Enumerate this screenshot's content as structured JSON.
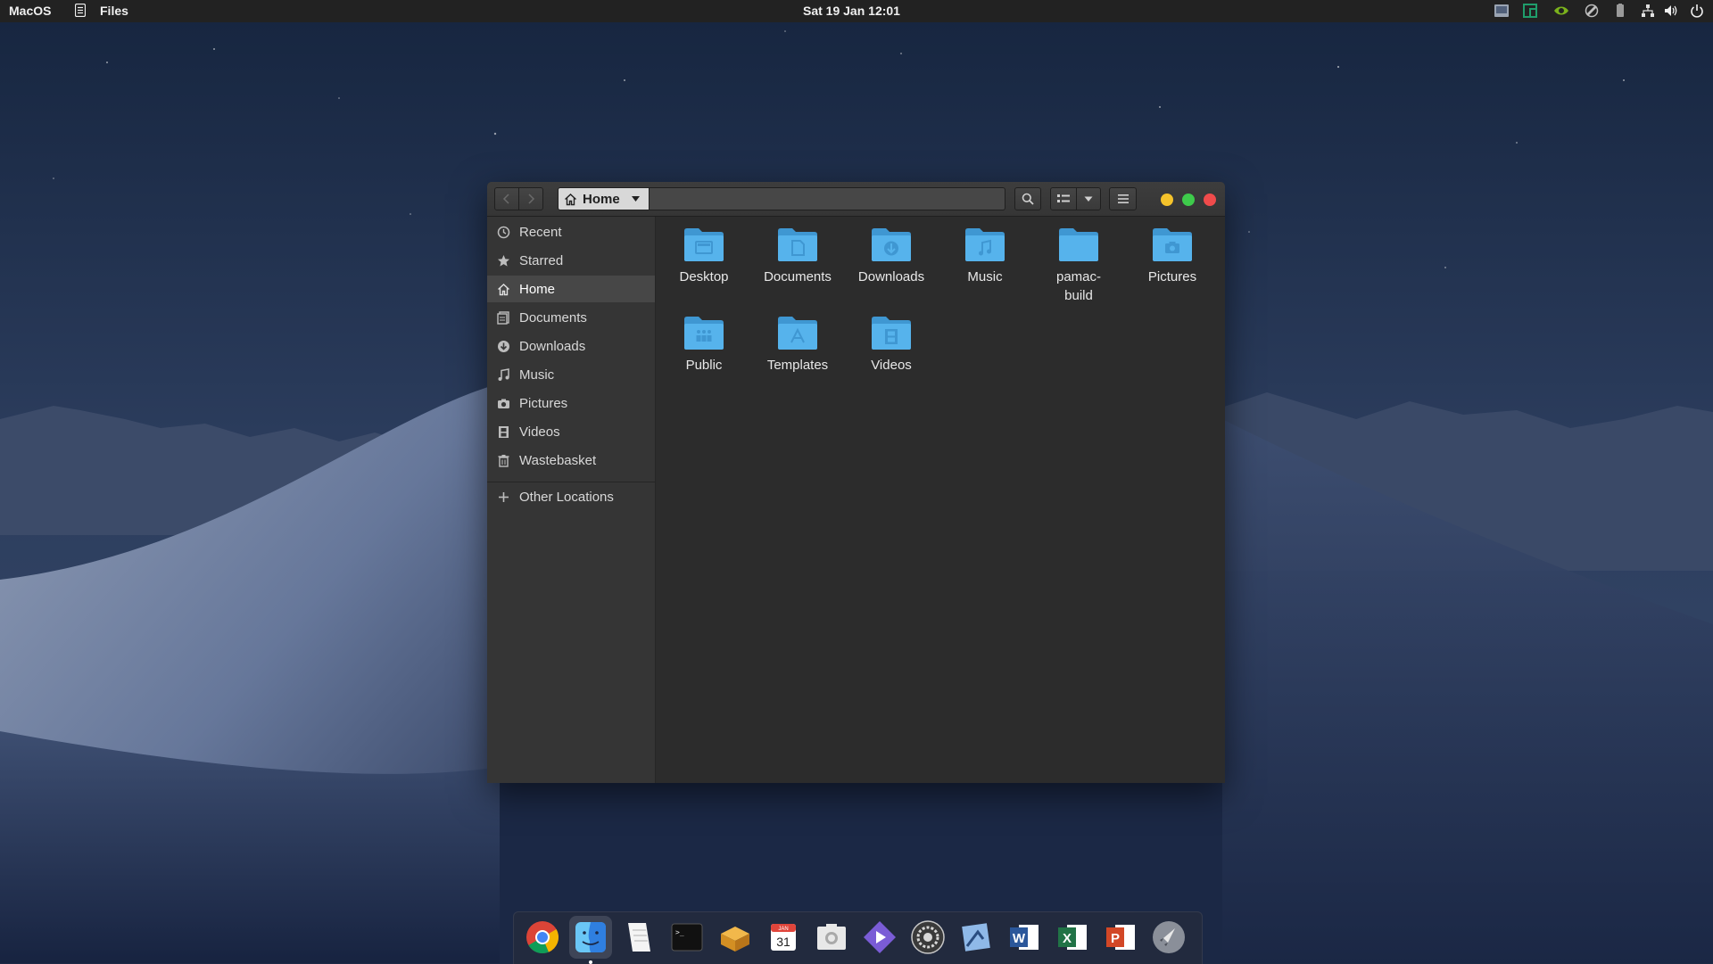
{
  "topbar": {
    "app_menu": "MacOS",
    "active_app": "Files",
    "clock": "Sat 19 Jan 12:01",
    "tray_icons": [
      "screenshot-tray-icon",
      "manjaro-tray-icon",
      "nvidia-tray-icon",
      "sync-tray-icon",
      "battery-tray-icon",
      "network-tray-icon",
      "volume-tray-icon",
      "power-tray-icon"
    ]
  },
  "window": {
    "path_label": "Home",
    "sidebar": [
      {
        "label": "Recent",
        "icon": "clock-icon"
      },
      {
        "label": "Starred",
        "icon": "star-icon"
      },
      {
        "label": "Home",
        "icon": "home-icon",
        "active": true
      },
      {
        "label": "Documents",
        "icon": "documents-icon"
      },
      {
        "label": "Downloads",
        "icon": "download-icon"
      },
      {
        "label": "Music",
        "icon": "music-note-icon"
      },
      {
        "label": "Pictures",
        "icon": "camera-icon"
      },
      {
        "label": "Videos",
        "icon": "film-icon"
      },
      {
        "label": "Wastebasket",
        "icon": "trash-icon"
      }
    ],
    "other_locations": "Other Locations",
    "folders": [
      {
        "label": "Desktop",
        "icon": "desktop-folder-icon"
      },
      {
        "label": "Documents",
        "icon": "documents-folder-icon"
      },
      {
        "label": "Downloads",
        "icon": "downloads-folder-icon"
      },
      {
        "label": "Music",
        "icon": "music-folder-icon"
      },
      {
        "label": "pamac-build",
        "icon": "folder-icon"
      },
      {
        "label": "Pictures",
        "icon": "pictures-folder-icon"
      },
      {
        "label": "Public",
        "icon": "public-folder-icon"
      },
      {
        "label": "Templates",
        "icon": "templates-folder-icon"
      },
      {
        "label": "Videos",
        "icon": "videos-folder-icon"
      }
    ]
  },
  "dock": {
    "apps": [
      "chrome-icon",
      "finder-icon",
      "text-editor-icon",
      "terminal-icon",
      "archive-icon",
      "calendar-icon",
      "screenshot-icon",
      "media-player-icon",
      "settings-icon",
      "preview-icon",
      "word-icon",
      "excel-icon",
      "powerpoint-icon",
      "launchpad-icon"
    ],
    "calendar_day": "31",
    "calendar_month": "JAN",
    "terminal_prompt": ">_",
    "word_letter": "W",
    "excel_letter": "X",
    "powerpoint_letter": "P"
  },
  "colors": {
    "folder_blue": "#56b3ec",
    "folder_blue_dark": "#3f97d2",
    "accent_close": "#f04b4b",
    "accent_min": "#f5c32b",
    "accent_max": "#3ecb4b"
  }
}
